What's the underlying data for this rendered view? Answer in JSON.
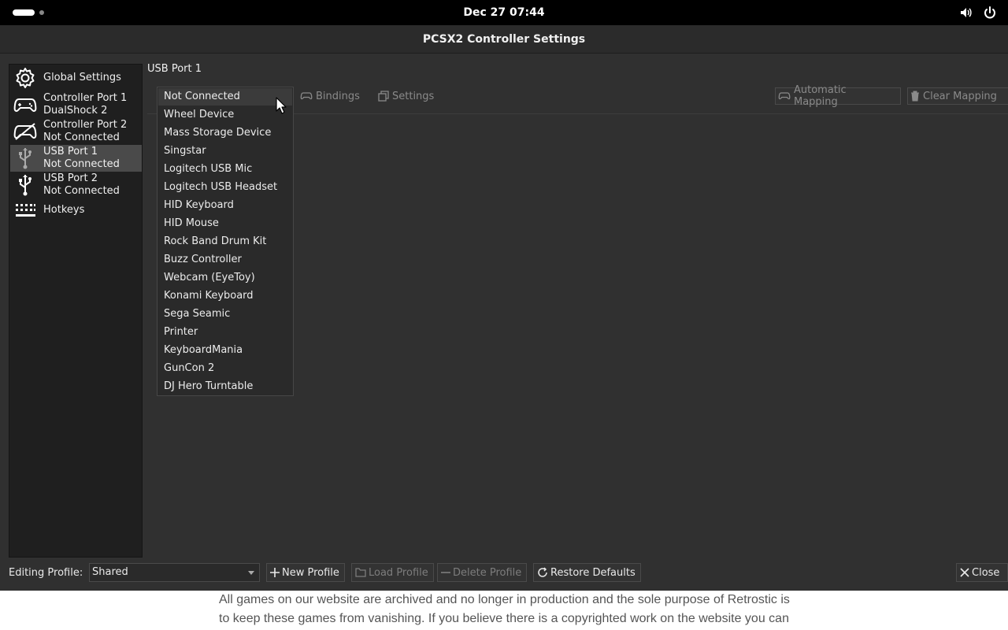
{
  "topbar": {
    "clock": "Dec 27  07:44"
  },
  "window": {
    "title": "PCSX2 Controller Settings"
  },
  "sidebar": {
    "items": [
      {
        "icon": "gear-icon",
        "line1": "Global Settings",
        "line2": ""
      },
      {
        "icon": "gamepad-icon",
        "line1": "Controller Port 1",
        "line2": "DualShock 2"
      },
      {
        "icon": "gamepad-disconnected-icon",
        "line1": "Controller Port 2",
        "line2": "Not Connected"
      },
      {
        "icon": "usb-icon",
        "line1": "USB Port 1",
        "line2": "Not Connected"
      },
      {
        "icon": "usb-icon",
        "line1": "USB Port 2",
        "line2": "Not Connected"
      },
      {
        "icon": "keyboard-icon",
        "line1": "Hotkeys",
        "line2": ""
      }
    ],
    "selected_index": 3
  },
  "main": {
    "port_title": "USB Port 1",
    "toolbar": {
      "bindings": "Bindings",
      "settings": "Settings",
      "automatic_mapping": "Automatic Mapping",
      "clear_mapping": "Clear Mapping"
    },
    "device_dropdown": {
      "selected": "Not Connected",
      "options": [
        "Not Connected",
        "Wheel Device",
        "Mass Storage Device",
        "Singstar",
        "Logitech USB Mic",
        "Logitech USB Headset",
        "HID Keyboard",
        "HID Mouse",
        "Rock Band Drum Kit",
        "Buzz Controller",
        "Webcam (EyeToy)",
        "Konami Keyboard",
        "Sega Seamic",
        "Printer",
        "KeyboardMania",
        "GunCon 2",
        "DJ Hero Turntable"
      ]
    }
  },
  "bottombar": {
    "profile_label": "Editing Profile:",
    "profile_value": "Shared",
    "new_profile": "New Profile",
    "load_profile": "Load Profile",
    "delete_profile": "Delete Profile",
    "restore_defaults": "Restore Defaults",
    "close": "Close"
  },
  "background_page": {
    "line1": "All games on our website are archived and no longer in production and the sole purpose of Retrostic is",
    "line2": "to keep these games from vanishing. If you believe there is a copyrighted work on the website you can"
  }
}
